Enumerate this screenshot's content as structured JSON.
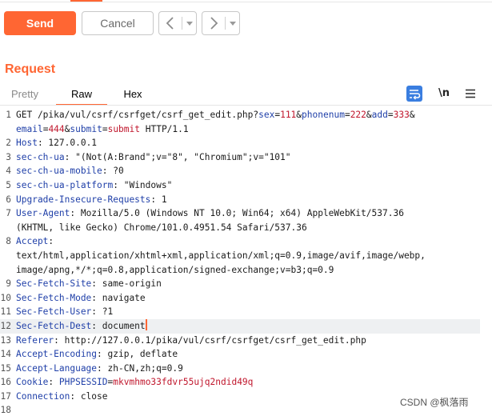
{
  "toolbar": {
    "send_label": "Send",
    "cancel_label": "Cancel",
    "prev_icon": "chevron-left-icon",
    "next_icon": "chevron-right-icon",
    "accent_color": "#ff6633"
  },
  "panel": {
    "title": "Request"
  },
  "tabs": [
    {
      "label": "Pretty",
      "active": false
    },
    {
      "label": "Raw",
      "active": true
    },
    {
      "label": "Hex",
      "active": false
    }
  ],
  "tools": {
    "wrap_icon": "wrap-lines-icon",
    "newline_label": "\\n",
    "menu_icon": "hamburger-menu-icon"
  },
  "editor": {
    "lines": [
      {
        "n": "1",
        "text": "GET /pika/vul/csrf/csrfget/csrf_get_edit.php?"
      },
      {
        "n": "",
        "text": "email=444&submit=submit HTTP/1.1"
      },
      {
        "n": "2",
        "text": "Host: 127.0.0.1"
      },
      {
        "n": "3",
        "text": "sec-ch-ua: \"(Not(A:Brand\";v=\"8\", \"Chromium\";v=\"101\""
      },
      {
        "n": "4",
        "text": "sec-ch-ua-mobile: ?0"
      },
      {
        "n": "5",
        "text": "sec-ch-ua-platform: \"Windows\""
      },
      {
        "n": "6",
        "text": "Upgrade-Insecure-Requests: 1"
      },
      {
        "n": "7",
        "text": "User-Agent: Mozilla/5.0 (Windows NT 10.0; Win64; x64) AppleWebKit/537.36"
      },
      {
        "n": "",
        "text": "(KHTML, like Gecko) Chrome/101.0.4951.54 Safari/537.36"
      },
      {
        "n": "8",
        "text": "Accept:"
      },
      {
        "n": "",
        "text": "text/html,application/xhtml+xml,application/xml;q=0.9,image/avif,image/webp,"
      },
      {
        "n": "",
        "text": "image/apng,*/*;q=0.8,application/signed-exchange;v=b3;q=0.9"
      },
      {
        "n": "9",
        "text": "Sec-Fetch-Site: same-origin"
      },
      {
        "n": "10",
        "text": "Sec-Fetch-Mode: navigate"
      },
      {
        "n": "11",
        "text": "Sec-Fetch-User: ?1"
      },
      {
        "n": "12",
        "text": "Sec-Fetch-Dest: document"
      },
      {
        "n": "13",
        "text": "Referer: http://127.0.0.1/pika/vul/csrf/csrfget/csrf_get_edit.php"
      },
      {
        "n": "14",
        "text": "Accept-Encoding: gzip, deflate"
      },
      {
        "n": "15",
        "text": "Accept-Language: zh-CN,zh;q=0.9"
      },
      {
        "n": "16",
        "text": "Cookie: PHPSESSID=mkvmhmo33fdvr55ujq2ndid49q"
      },
      {
        "n": "17",
        "text": "Connection: close"
      },
      {
        "n": "18",
        "text": ""
      }
    ],
    "current_line": "12",
    "header_color": "#1f3fa8",
    "param_value_color": "#c0162c"
  },
  "watermark": "CSDN @枫落雨"
}
